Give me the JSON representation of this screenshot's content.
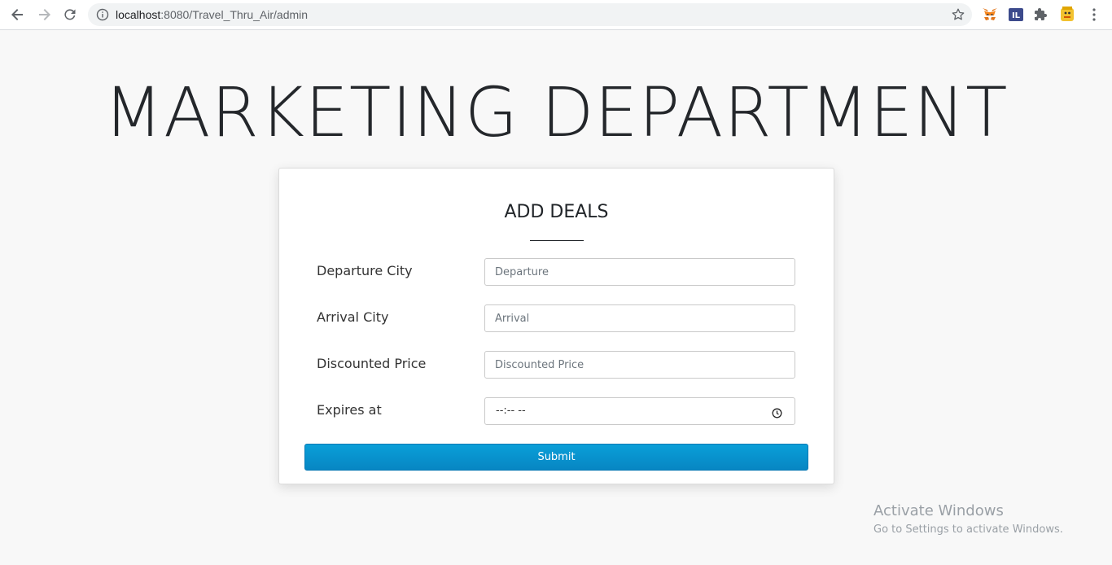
{
  "browser": {
    "url_host": "localhost",
    "url_rest": ":8080/Travel_Thru_Air/admin",
    "icons": [
      "back-icon",
      "forward-icon",
      "reload-icon",
      "info-icon",
      "star-icon",
      "metamask-extension-icon",
      "il-extension-icon",
      "extensions-puzzle-icon",
      "profile-avatar-icon",
      "menu-kebab-icon"
    ]
  },
  "page": {
    "title": "MARKETING DEPARTMENT"
  },
  "form": {
    "heading": "ADD DEALS",
    "fields": [
      {
        "label": "Departure City",
        "placeholder": "Departure",
        "value": ""
      },
      {
        "label": "Arrival City",
        "placeholder": "Arrival",
        "value": ""
      },
      {
        "label": "Discounted Price",
        "placeholder": "Discounted Price",
        "value": ""
      },
      {
        "label": "Expires at",
        "value": "--:-- --"
      }
    ],
    "submit_label": "Submit",
    "accent_color": "#0894cd"
  },
  "watermark": {
    "title": "Activate Windows",
    "subtitle": "Go to Settings to activate Windows."
  }
}
